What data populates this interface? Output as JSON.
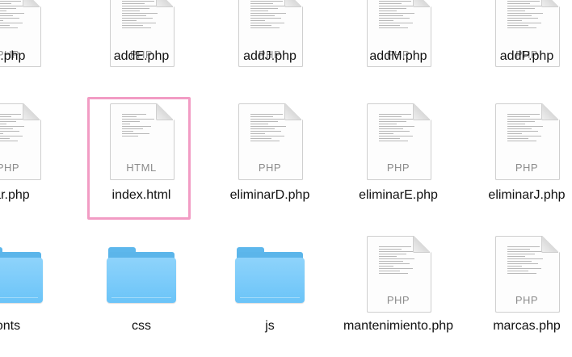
{
  "items": [
    {
      "name": "D.php",
      "type": "php",
      "ext": "PHP",
      "col": 0,
      "row": 0
    },
    {
      "name": "addE.php",
      "type": "php",
      "ext": "PHP",
      "col": 1,
      "row": 0
    },
    {
      "name": "addJ.php",
      "type": "php",
      "ext": "PHP",
      "col": 2,
      "row": 0
    },
    {
      "name": "addM.php",
      "type": "php",
      "ext": "PHP",
      "col": 3,
      "row": 0
    },
    {
      "name": "addP.php",
      "type": "php",
      "ext": "PHP",
      "col": 4,
      "row": 0
    },
    {
      "name": "gar.php",
      "type": "php",
      "ext": "PHP",
      "col": 0,
      "row": 1
    },
    {
      "name": "index.html",
      "type": "html",
      "ext": "HTML",
      "col": 1,
      "row": 1,
      "selected": true
    },
    {
      "name": "eliminarD.php",
      "type": "php",
      "ext": "PHP",
      "col": 2,
      "row": 1
    },
    {
      "name": "eliminarE.php",
      "type": "php",
      "ext": "PHP",
      "col": 3,
      "row": 1
    },
    {
      "name": "eliminarJ.php",
      "type": "php",
      "ext": "PHP",
      "col": 4,
      "row": 1
    },
    {
      "name": "onts",
      "type": "folder",
      "col": 0,
      "row": 2
    },
    {
      "name": "css",
      "type": "folder",
      "col": 1,
      "row": 2
    },
    {
      "name": "js",
      "type": "folder",
      "col": 2,
      "row": 2
    },
    {
      "name": "mantenimiento.php",
      "type": "php",
      "ext": "PHP",
      "col": 3,
      "row": 2
    },
    {
      "name": "marcas.php",
      "type": "php",
      "ext": "PHP",
      "col": 4,
      "row": 2
    }
  ],
  "selection_color": "#f29cc4",
  "folder_color": "#6bc4f8"
}
